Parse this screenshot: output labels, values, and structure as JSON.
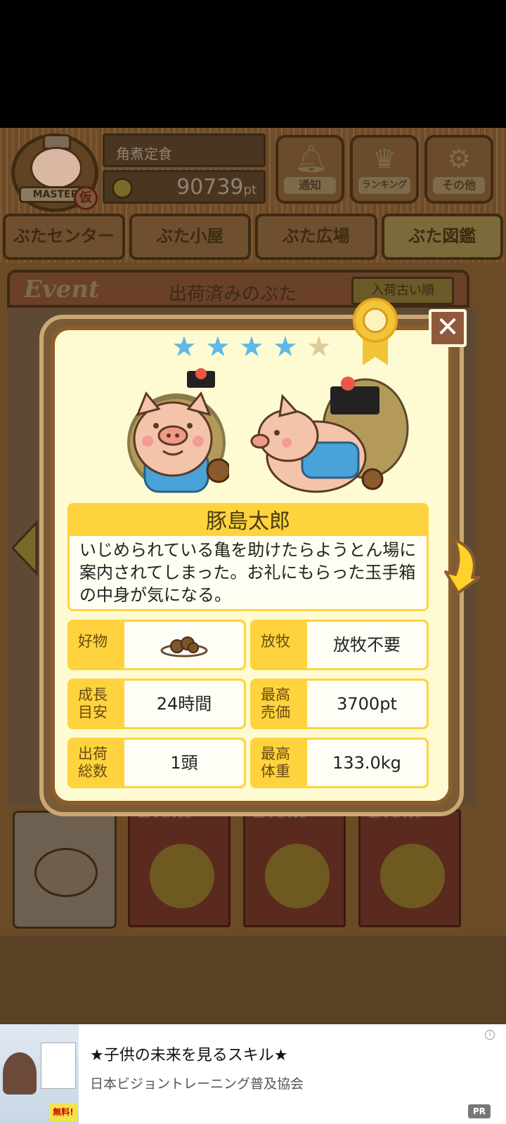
{
  "header": {
    "badge_ribbon": "MASTER",
    "badge_mark": "仮",
    "menu_name": "角煮定食",
    "points_value": "90739",
    "points_unit": "pt",
    "buttons": [
      {
        "label": "通知",
        "icon": "bell-icon"
      },
      {
        "label": "ランキング",
        "icon": "crown-icon"
      },
      {
        "label": "その他",
        "icon": "gear-icon"
      }
    ]
  },
  "tabs": [
    "ぶたセンター",
    "ぶた小屋",
    "ぶた広場",
    "ぶた図鑑"
  ],
  "active_tab": "ぶた図鑑",
  "event_bar": {
    "event_label": "Event",
    "title": "出荷済みのぶた",
    "sort_label": "入荷古い順"
  },
  "cards": [
    {
      "event_label": "Event"
    },
    {
      "event_label": "Event"
    },
    {
      "event_label": "Event"
    }
  ],
  "modal": {
    "rating": 4,
    "rating_max": 5,
    "pig_name": "豚島太郎",
    "description": "いじめられている亀を助けたらようとん場に案内されてしまった。お礼にもらった玉手箱の中身が気になる。",
    "close_symbol": "✕",
    "info": {
      "favorite_label": "好物",
      "favorite_icon": "meatballs-plate-icon",
      "graze_label": "放牧",
      "graze_value": "放牧不要",
      "growth_label": "成長目安",
      "growth_value": "24時間",
      "price_label": "最高売価",
      "price_value": "3700pt",
      "shipped_label": "出荷総数",
      "shipped_value": "1頭",
      "weight_label": "最高体重",
      "weight_value": "133.0kg"
    }
  },
  "ad": {
    "title": "★子供の未来を見るスキル★",
    "sponsor": "日本ビジョントレーニング普及協会",
    "pr_label": "PR",
    "thumb_free": "無料!",
    "info_icon": "i"
  },
  "colors": {
    "modal_bg": "#fefbd2",
    "label_yellow": "#ffd33d",
    "star_on": "#5fb8e6",
    "star_off": "#dccb9b",
    "frame_brown": "#8c5e2c"
  }
}
